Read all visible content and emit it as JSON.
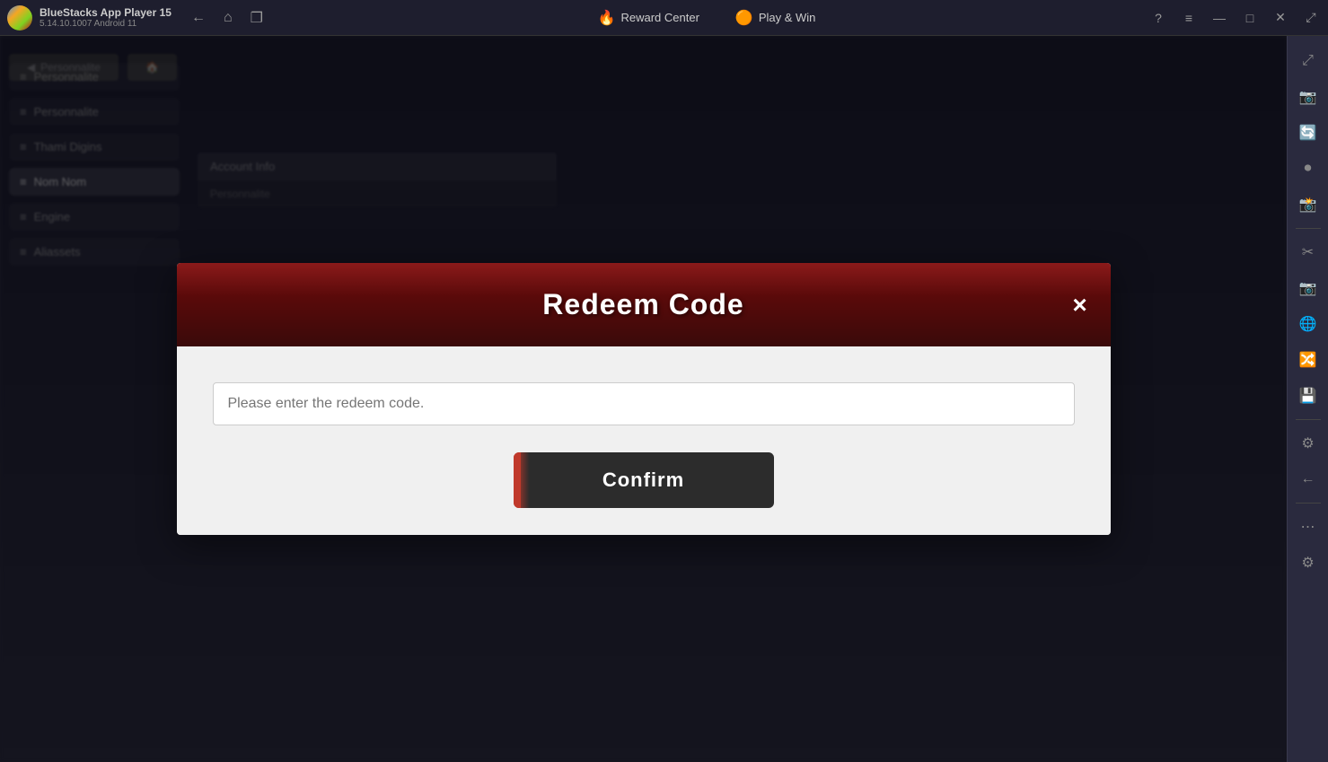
{
  "titleBar": {
    "appName": "BlueStacks App Player 15",
    "version": "5.14.10.1007  Android 11",
    "rewardCenter": "Reward Center",
    "playAndWin": "Play & Win",
    "navBack": "←",
    "navHome": "⌂",
    "navTabs": "❐",
    "helpIcon": "?",
    "menuIcon": "≡",
    "minimizeIcon": "—",
    "maximizeIcon": "□",
    "closeIcon": "✕",
    "expandIcon": "⤢"
  },
  "rightSidebar": {
    "icons": [
      "⤢",
      "📷",
      "🔄",
      "⏺",
      "📸",
      "✂",
      "📷",
      "⚙",
      "←",
      "⋯",
      "⚙"
    ]
  },
  "dialog": {
    "title": "Redeem Code",
    "closeButton": "×",
    "inputPlaceholder": "Please enter the redeem code.",
    "confirmButton": "Confirm"
  },
  "background": {
    "topBtn1": "Personnalite",
    "topBtn2": "🏠",
    "menuItems": [
      {
        "label": "Personnalite",
        "icon": "≡"
      },
      {
        "label": "Personnalite",
        "icon": "≡"
      },
      {
        "label": "Thami Digins",
        "icon": "≡"
      },
      {
        "label": "Nom Nom",
        "icon": "≡"
      },
      {
        "label": "Engine",
        "icon": "≡"
      },
      {
        "label": "Aliassets",
        "icon": "≡"
      }
    ],
    "sectionTitle": "Account Info",
    "sectionSubtitle": "Personnalite"
  }
}
